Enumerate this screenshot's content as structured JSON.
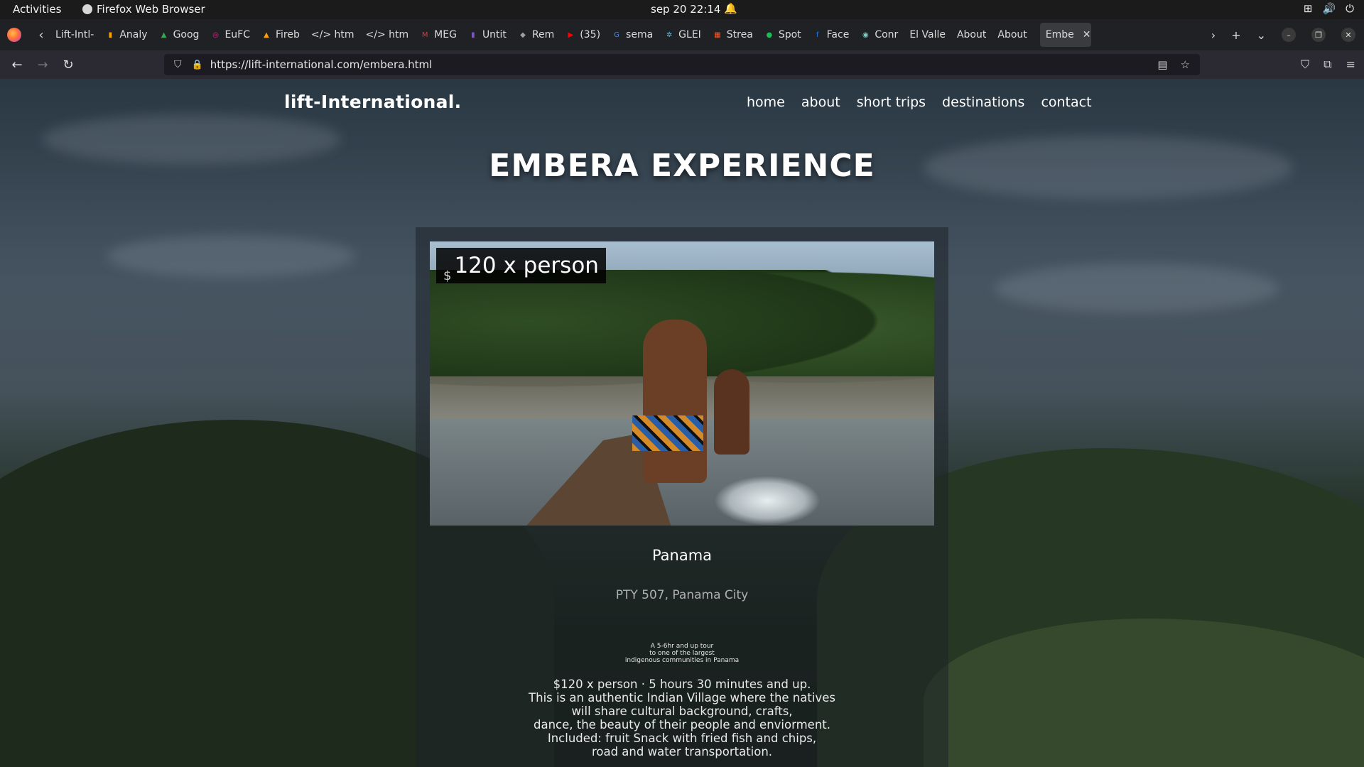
{
  "system": {
    "activities": "Activities",
    "app_name": "Firefox Web Browser",
    "clock": "sep 20  22:14"
  },
  "tabs": [
    {
      "label": "Lift-Intl-",
      "fav": "",
      "color": ""
    },
    {
      "label": "Analy",
      "fav": "▮",
      "color": "#f4a300"
    },
    {
      "label": "Goog",
      "fav": "▲",
      "color": "#34a853"
    },
    {
      "label": "EuFC",
      "fav": "◎",
      "color": "#c13584"
    },
    {
      "label": "Fireb",
      "fav": "▲",
      "color": "#ffa000"
    },
    {
      "label": "</> htm",
      "fav": "",
      "color": ""
    },
    {
      "label": "</> htm",
      "fav": "",
      "color": ""
    },
    {
      "label": "MEG",
      "fav": "M",
      "color": "#e53935"
    },
    {
      "label": "Untit",
      "fav": "▮",
      "color": "#7e57c2"
    },
    {
      "label": "Rem",
      "fav": "◆",
      "color": "#9e9e9e"
    },
    {
      "label": "(35)",
      "fav": "▶",
      "color": "#ff0000"
    },
    {
      "label": "sema",
      "fav": "G",
      "color": "#4285f4"
    },
    {
      "label": "GLEI",
      "fav": "✲",
      "color": "#4fc3f7"
    },
    {
      "label": "Strea",
      "fav": "▦",
      "color": "#ff5722"
    },
    {
      "label": "Spot",
      "fav": "●",
      "color": "#1db954"
    },
    {
      "label": "Face",
      "fav": "f",
      "color": "#1877f2"
    },
    {
      "label": "Conr",
      "fav": "◉",
      "color": "#80cbc4"
    },
    {
      "label": "El Valle",
      "fav": "",
      "color": ""
    },
    {
      "label": "About",
      "fav": "",
      "color": ""
    },
    {
      "label": "About",
      "fav": "",
      "color": ""
    }
  ],
  "active_tab": {
    "label": "Embe"
  },
  "navbar": {
    "url": "https://lift-international.com/embera.html"
  },
  "site": {
    "brand": "lift-International.",
    "menu": [
      "home",
      "about",
      "short trips",
      "destinations",
      "contact"
    ],
    "title": "EMBERA EXPERIENCE"
  },
  "card": {
    "price_currency": "$",
    "price_amount": "120 x person",
    "place": "Panama",
    "address": "PTY 507, Panama City",
    "blurb": [
      "A 5-6hr and up tour",
      "to one of the largest",
      "indigenous communities in Panama"
    ],
    "description": [
      "$120 x person · 5 hours 30 minutes and up.",
      "This is an authentic Indian Village where the natives",
      "will share cultural background, crafts,",
      "dance, the beauty of their people and enviorment.",
      "Included: fruit Snack with fried fish and chips,",
      "road and water transportation."
    ]
  }
}
